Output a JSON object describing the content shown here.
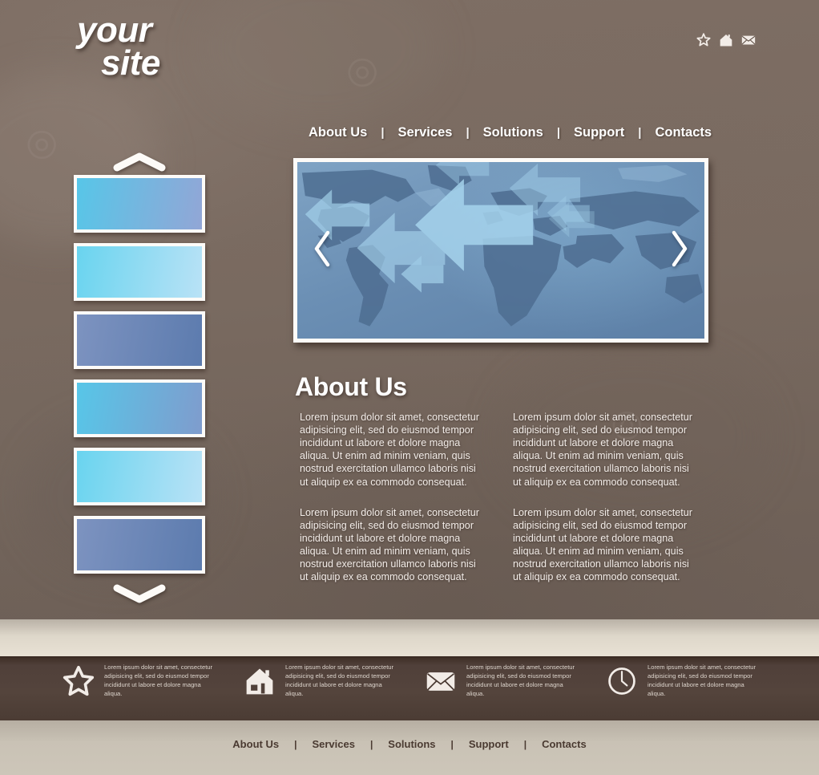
{
  "site": {
    "logo_line1": "your",
    "logo_line2": "site"
  },
  "header": {
    "icons": [
      {
        "name": "star-icon",
        "label": "Bookmark"
      },
      {
        "name": "home-icon",
        "label": "Home"
      },
      {
        "name": "mail-icon",
        "label": "Mail"
      }
    ]
  },
  "nav": {
    "separator": "|",
    "items": [
      {
        "label": "About Us"
      },
      {
        "label": "Services"
      },
      {
        "label": "Solutions"
      },
      {
        "label": "Support"
      },
      {
        "label": "Contacts"
      }
    ]
  },
  "thumb_rail": {
    "up_arrow": "chevron-up",
    "down_arrow": "chevron-down",
    "thumbnails": [
      {
        "from": "#57c6e8",
        "to": "#92a6d6"
      },
      {
        "from": "#69d4ef",
        "to": "#b9e2f6"
      },
      {
        "from": "#7d93c0",
        "to": "#5c7bae"
      },
      {
        "from": "#57c6e8",
        "to": "#7f9ccd"
      },
      {
        "from": "#69d4ef",
        "to": "#b9e2f6"
      },
      {
        "from": "#7d93c0",
        "to": "#5c7bae"
      }
    ]
  },
  "banner": {
    "alt": "world map with blue arrows",
    "prev_label": "‹",
    "next_label": "›"
  },
  "about": {
    "title": "About Us",
    "paragraphs": [
      "Lorem ipsum dolor sit amet, consectetur adipisicing elit, sed do eiusmod tempor incididunt ut labore et dolore magna aliqua. Ut enim ad minim veniam, quis nostrud exercitation ullamco laboris nisi ut aliquip ex ea commodo consequat.",
      "Lorem ipsum dolor sit amet, consectetur adipisicing elit, sed do eiusmod tempor incididunt ut labore et dolore magna aliqua. Ut enim ad minim veniam, quis nostrud exercitation ullamco laboris nisi ut aliquip ex ea commodo consequat.",
      "Lorem ipsum dolor sit amet, consectetur adipisicing elit, sed do eiusmod tempor incididunt ut labore et dolore magna aliqua. Ut enim ad minim veniam, quis nostrud exercitation ullamco laboris nisi ut aliquip ex ea commodo consequat.",
      "Lorem ipsum dolor sit amet, consectetur adipisicing elit, sed do eiusmod tempor incididunt ut labore et dolore magna aliqua. Ut enim ad minim veniam, quis nostrud exercitation ullamco laboris nisi ut aliquip ex ea commodo consequat."
    ]
  },
  "footer_features": [
    {
      "icon": "star-icon",
      "text": "Lorem ipsum dolor sit amet, consectetur adipisicing elit, sed do eiusmod tempor incididunt ut labore et dolore magna aliqua."
    },
    {
      "icon": "home-icon",
      "text": "Lorem ipsum dolor sit amet, consectetur adipisicing elit, sed do eiusmod tempor incididunt ut labore et dolore magna aliqua."
    },
    {
      "icon": "mail-icon",
      "text": "Lorem ipsum dolor sit amet, consectetur adipisicing elit, sed do eiusmod tempor incididunt ut labore et dolore magna aliqua."
    },
    {
      "icon": "clock-icon",
      "text": "Lorem ipsum dolor sit amet, consectetur adipisicing elit, sed do eiusmod tempor incididunt ut labore et dolore magna aliqua."
    }
  ],
  "footer_nav": {
    "separator": "|",
    "items": [
      {
        "label": "About Us"
      },
      {
        "label": "Services"
      },
      {
        "label": "Solutions"
      },
      {
        "label": "Support"
      },
      {
        "label": "Contacts"
      }
    ]
  },
  "colors": {
    "page_bg": "#7a6a61",
    "band_light": "#e0d9cc",
    "band_dark": "#51413a",
    "nav_text": "#ffffff",
    "footer_nav_text": "#4a3a31",
    "frame": "#fdfbf8"
  }
}
